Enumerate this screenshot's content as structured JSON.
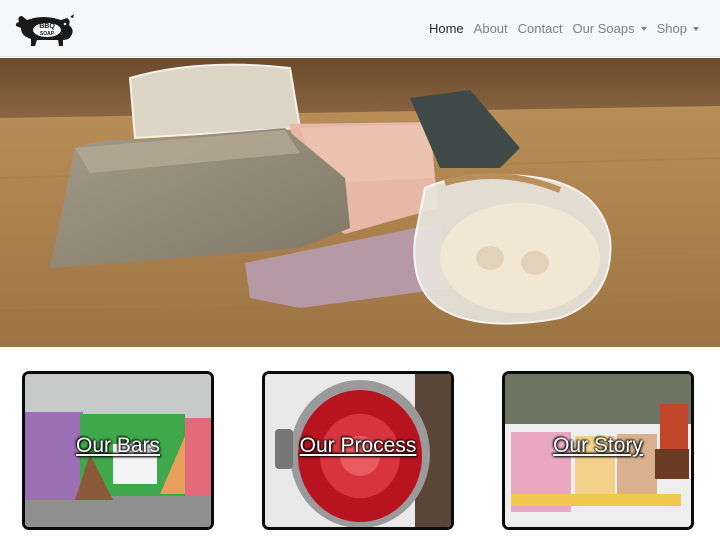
{
  "brand": {
    "logo_text_top": "BBQ",
    "logo_text_bottom": "SOAP"
  },
  "nav": {
    "items": [
      {
        "label": "Home",
        "active": true
      },
      {
        "label": "About"
      },
      {
        "label": "Contact"
      },
      {
        "label": "Our Soaps",
        "dropdown": true
      },
      {
        "label": "Shop",
        "dropdown": true
      }
    ]
  },
  "cards": [
    {
      "label": "Our Bars"
    },
    {
      "label": "Our Process"
    },
    {
      "label": "Our Story"
    }
  ],
  "colors": {
    "nav_bg": "#f5f7f9",
    "nav_text": "#7c7f83",
    "nav_active": "#25292d",
    "card_border": "#0b0b0b"
  }
}
